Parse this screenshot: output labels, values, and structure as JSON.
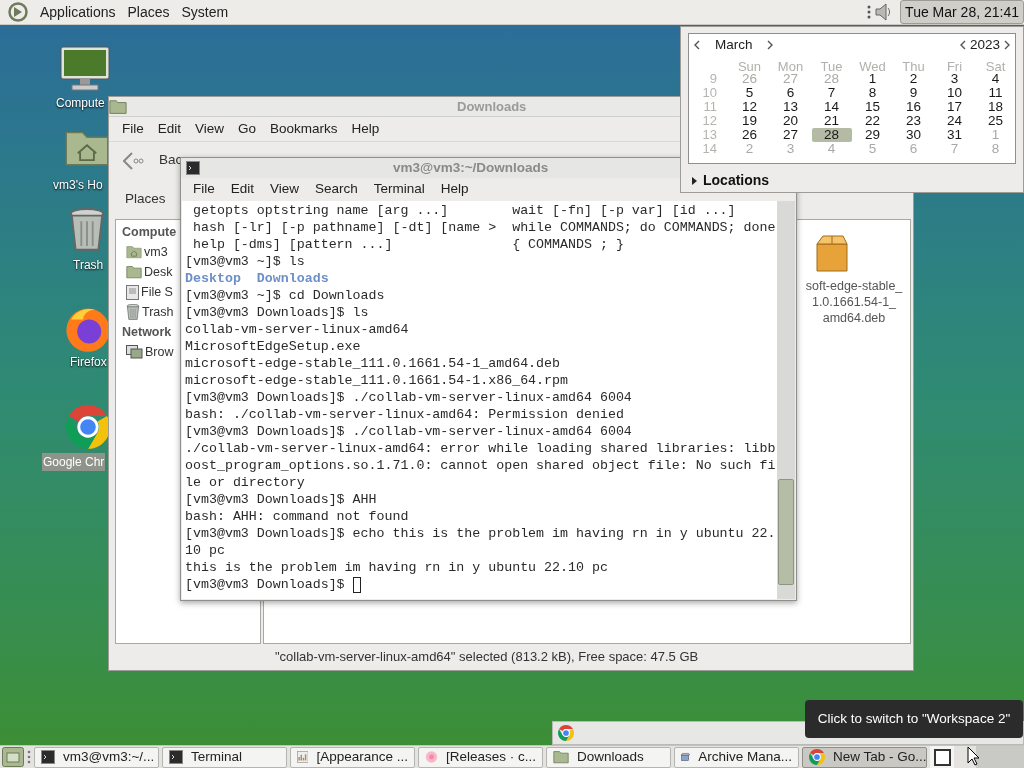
{
  "top_panel": {
    "menus": [
      "Applications",
      "Places",
      "System"
    ],
    "clock": "Tue Mar 28, 21:41",
    "clock_pressed": true
  },
  "desktop_icons": [
    {
      "label": "Compute",
      "kind": "computer",
      "selected": false
    },
    {
      "label": "vm3's Ho",
      "kind": "home",
      "selected": false
    },
    {
      "label": "Trash",
      "kind": "trash",
      "selected": false
    },
    {
      "label": "Firefox",
      "kind": "firefox",
      "selected": false
    },
    {
      "label": "Google Chr",
      "kind": "chrome",
      "selected": true
    }
  ],
  "file_manager": {
    "title": "Downloads",
    "menu": [
      "File",
      "Edit",
      "View",
      "Go",
      "Bookmarks",
      "Help"
    ],
    "back_label": "Bac",
    "places_label": "Places",
    "sidebar": [
      {
        "kind": "heading",
        "label": "Compute"
      },
      {
        "kind": "home",
        "label": "vm3"
      },
      {
        "kind": "desktop",
        "label": "Desk"
      },
      {
        "kind": "drive",
        "label": "File S"
      },
      {
        "kind": "trash",
        "label": "Trash"
      },
      {
        "kind": "heading",
        "label": "Network"
      },
      {
        "kind": "network",
        "label": "Brow"
      }
    ],
    "file_label_lines": [
      "soft-edge-stable_",
      "1.0.1661.54-1_",
      "amd64.deb"
    ],
    "status": "\"collab-vm-server-linux-amd64\" selected (813.2 kB), Free space: 47.5 GB"
  },
  "terminal": {
    "title": "vm3@vm3:~/Downloads",
    "menu": [
      "File",
      "Edit",
      "View",
      "Search",
      "Terminal",
      "Help"
    ],
    "lines": [
      {
        "kind": "text",
        "text": " getopts optstring name [arg ...]        wait [-fn] [-p var] [id ...]"
      },
      {
        "kind": "text",
        "text": " hash [-lr] [-p pathname] [-dt] [name >  while COMMANDS; do COMMANDS; done"
      },
      {
        "kind": "text",
        "text": " help [-dms] [pattern ...]               { COMMANDS ; }"
      },
      {
        "kind": "text",
        "text": "[vm3@vm3 ~]$ ls"
      },
      {
        "kind": "dirs",
        "text": "Desktop  Downloads"
      },
      {
        "kind": "text",
        "text": "[vm3@vm3 ~]$ cd Downloads"
      },
      {
        "kind": "text",
        "text": "[vm3@vm3 Downloads]$ ls"
      },
      {
        "kind": "text",
        "text": "collab-vm-server-linux-amd64"
      },
      {
        "kind": "text",
        "text": "MicrosoftEdgeSetup.exe"
      },
      {
        "kind": "text",
        "text": "microsoft-edge-stable_111.0.1661.54-1_amd64.deb"
      },
      {
        "kind": "text",
        "text": "microsoft-edge-stable_111.0.1661.54-1.x86_64.rpm"
      },
      {
        "kind": "text",
        "text": "[vm3@vm3 Downloads]$ ./collab-vm-server-linux-amd64 6004"
      },
      {
        "kind": "text",
        "text": "bash: ./collab-vm-server-linux-amd64: Permission denied"
      },
      {
        "kind": "text",
        "text": "[vm3@vm3 Downloads]$ ./collab-vm-server-linux-amd64 6004"
      },
      {
        "kind": "text",
        "text": "./collab-vm-server-linux-amd64: error while loading shared libraries: libb"
      },
      {
        "kind": "text",
        "text": "oost_program_options.so.1.71.0: cannot open shared object file: No such fi"
      },
      {
        "kind": "text",
        "text": "le or directory"
      },
      {
        "kind": "text",
        "text": "[vm3@vm3 Downloads]$ AHH"
      },
      {
        "kind": "text",
        "text": "bash: AHH: command not found"
      },
      {
        "kind": "text",
        "text": "[vm3@vm3 Downloads]$ echo this is the problem im having rn in y ubuntu 22."
      },
      {
        "kind": "text",
        "text": "10 pc"
      },
      {
        "kind": "text",
        "text": "this is the problem im having rn in y ubuntu 22.10 pc"
      },
      {
        "kind": "prompt",
        "text": "[vm3@vm3 Downloads]$"
      }
    ]
  },
  "calendar": {
    "month": "March",
    "year": "2023",
    "weekdays": [
      "Sun",
      "Mon",
      "Tue",
      "Wed",
      "Thu",
      "Fri",
      "Sat"
    ],
    "weeks": [
      {
        "number": "9",
        "days": [
          {
            "label": "26",
            "in_month": false,
            "selected": false
          },
          {
            "label": "27",
            "in_month": false,
            "selected": false
          },
          {
            "label": "28",
            "in_month": false,
            "selected": false
          },
          {
            "label": "1",
            "in_month": true,
            "selected": false
          },
          {
            "label": "2",
            "in_month": true,
            "selected": false
          },
          {
            "label": "3",
            "in_month": true,
            "selected": false
          },
          {
            "label": "4",
            "in_month": true,
            "selected": false
          }
        ]
      },
      {
        "number": "10",
        "days": [
          {
            "label": "5",
            "in_month": true,
            "selected": false
          },
          {
            "label": "6",
            "in_month": true,
            "selected": false
          },
          {
            "label": "7",
            "in_month": true,
            "selected": false
          },
          {
            "label": "8",
            "in_month": true,
            "selected": false
          },
          {
            "label": "9",
            "in_month": true,
            "selected": false
          },
          {
            "label": "10",
            "in_month": true,
            "selected": false
          },
          {
            "label": "11",
            "in_month": true,
            "selected": false
          }
        ]
      },
      {
        "number": "11",
        "days": [
          {
            "label": "12",
            "in_month": true,
            "selected": false
          },
          {
            "label": "13",
            "in_month": true,
            "selected": false
          },
          {
            "label": "14",
            "in_month": true,
            "selected": false
          },
          {
            "label": "15",
            "in_month": true,
            "selected": false
          },
          {
            "label": "16",
            "in_month": true,
            "selected": false
          },
          {
            "label": "17",
            "in_month": true,
            "selected": false
          },
          {
            "label": "18",
            "in_month": true,
            "selected": false
          }
        ]
      },
      {
        "number": "12",
        "days": [
          {
            "label": "19",
            "in_month": true,
            "selected": false
          },
          {
            "label": "20",
            "in_month": true,
            "selected": false
          },
          {
            "label": "21",
            "in_month": true,
            "selected": false
          },
          {
            "label": "22",
            "in_month": true,
            "selected": false
          },
          {
            "label": "23",
            "in_month": true,
            "selected": false
          },
          {
            "label": "24",
            "in_month": true,
            "selected": false
          },
          {
            "label": "25",
            "in_month": true,
            "selected": false
          }
        ]
      },
      {
        "number": "13",
        "days": [
          {
            "label": "26",
            "in_month": true,
            "selected": false
          },
          {
            "label": "27",
            "in_month": true,
            "selected": false
          },
          {
            "label": "28",
            "in_month": true,
            "selected": true
          },
          {
            "label": "29",
            "in_month": true,
            "selected": false
          },
          {
            "label": "30",
            "in_month": true,
            "selected": false
          },
          {
            "label": "31",
            "in_month": true,
            "selected": false
          },
          {
            "label": "1",
            "in_month": false,
            "selected": false
          }
        ]
      },
      {
        "number": "14",
        "days": [
          {
            "label": "2",
            "in_month": false,
            "selected": false
          },
          {
            "label": "3",
            "in_month": false,
            "selected": false
          },
          {
            "label": "4",
            "in_month": false,
            "selected": false
          },
          {
            "label": "5",
            "in_month": false,
            "selected": false
          },
          {
            "label": "6",
            "in_month": false,
            "selected": false
          },
          {
            "label": "7",
            "in_month": false,
            "selected": false
          },
          {
            "label": "8",
            "in_month": false,
            "selected": false
          }
        ]
      }
    ],
    "locations": {
      "label": "Locations",
      "expanded": false
    }
  },
  "tooltip": "Click to switch to \"Workspace 2\"",
  "taskbar": {
    "items": [
      {
        "label": "vm3@vm3:~/...",
        "kind": "terminal",
        "selected": false
      },
      {
        "label": "Terminal",
        "kind": "terminal",
        "selected": false
      },
      {
        "label": "[Appearance ...",
        "kind": "appearance",
        "selected": false
      },
      {
        "label": "[Releases · c...",
        "kind": "firefox",
        "selected": false
      },
      {
        "label": "Downloads",
        "kind": "folder",
        "selected": false
      },
      {
        "label": "Archive Mana...",
        "kind": "archive",
        "selected": false
      },
      {
        "label": "New Tab - Go...",
        "kind": "chrome",
        "selected": true
      }
    ],
    "workspaces": [
      {
        "selected": true
      },
      {
        "selected": false
      }
    ]
  }
}
